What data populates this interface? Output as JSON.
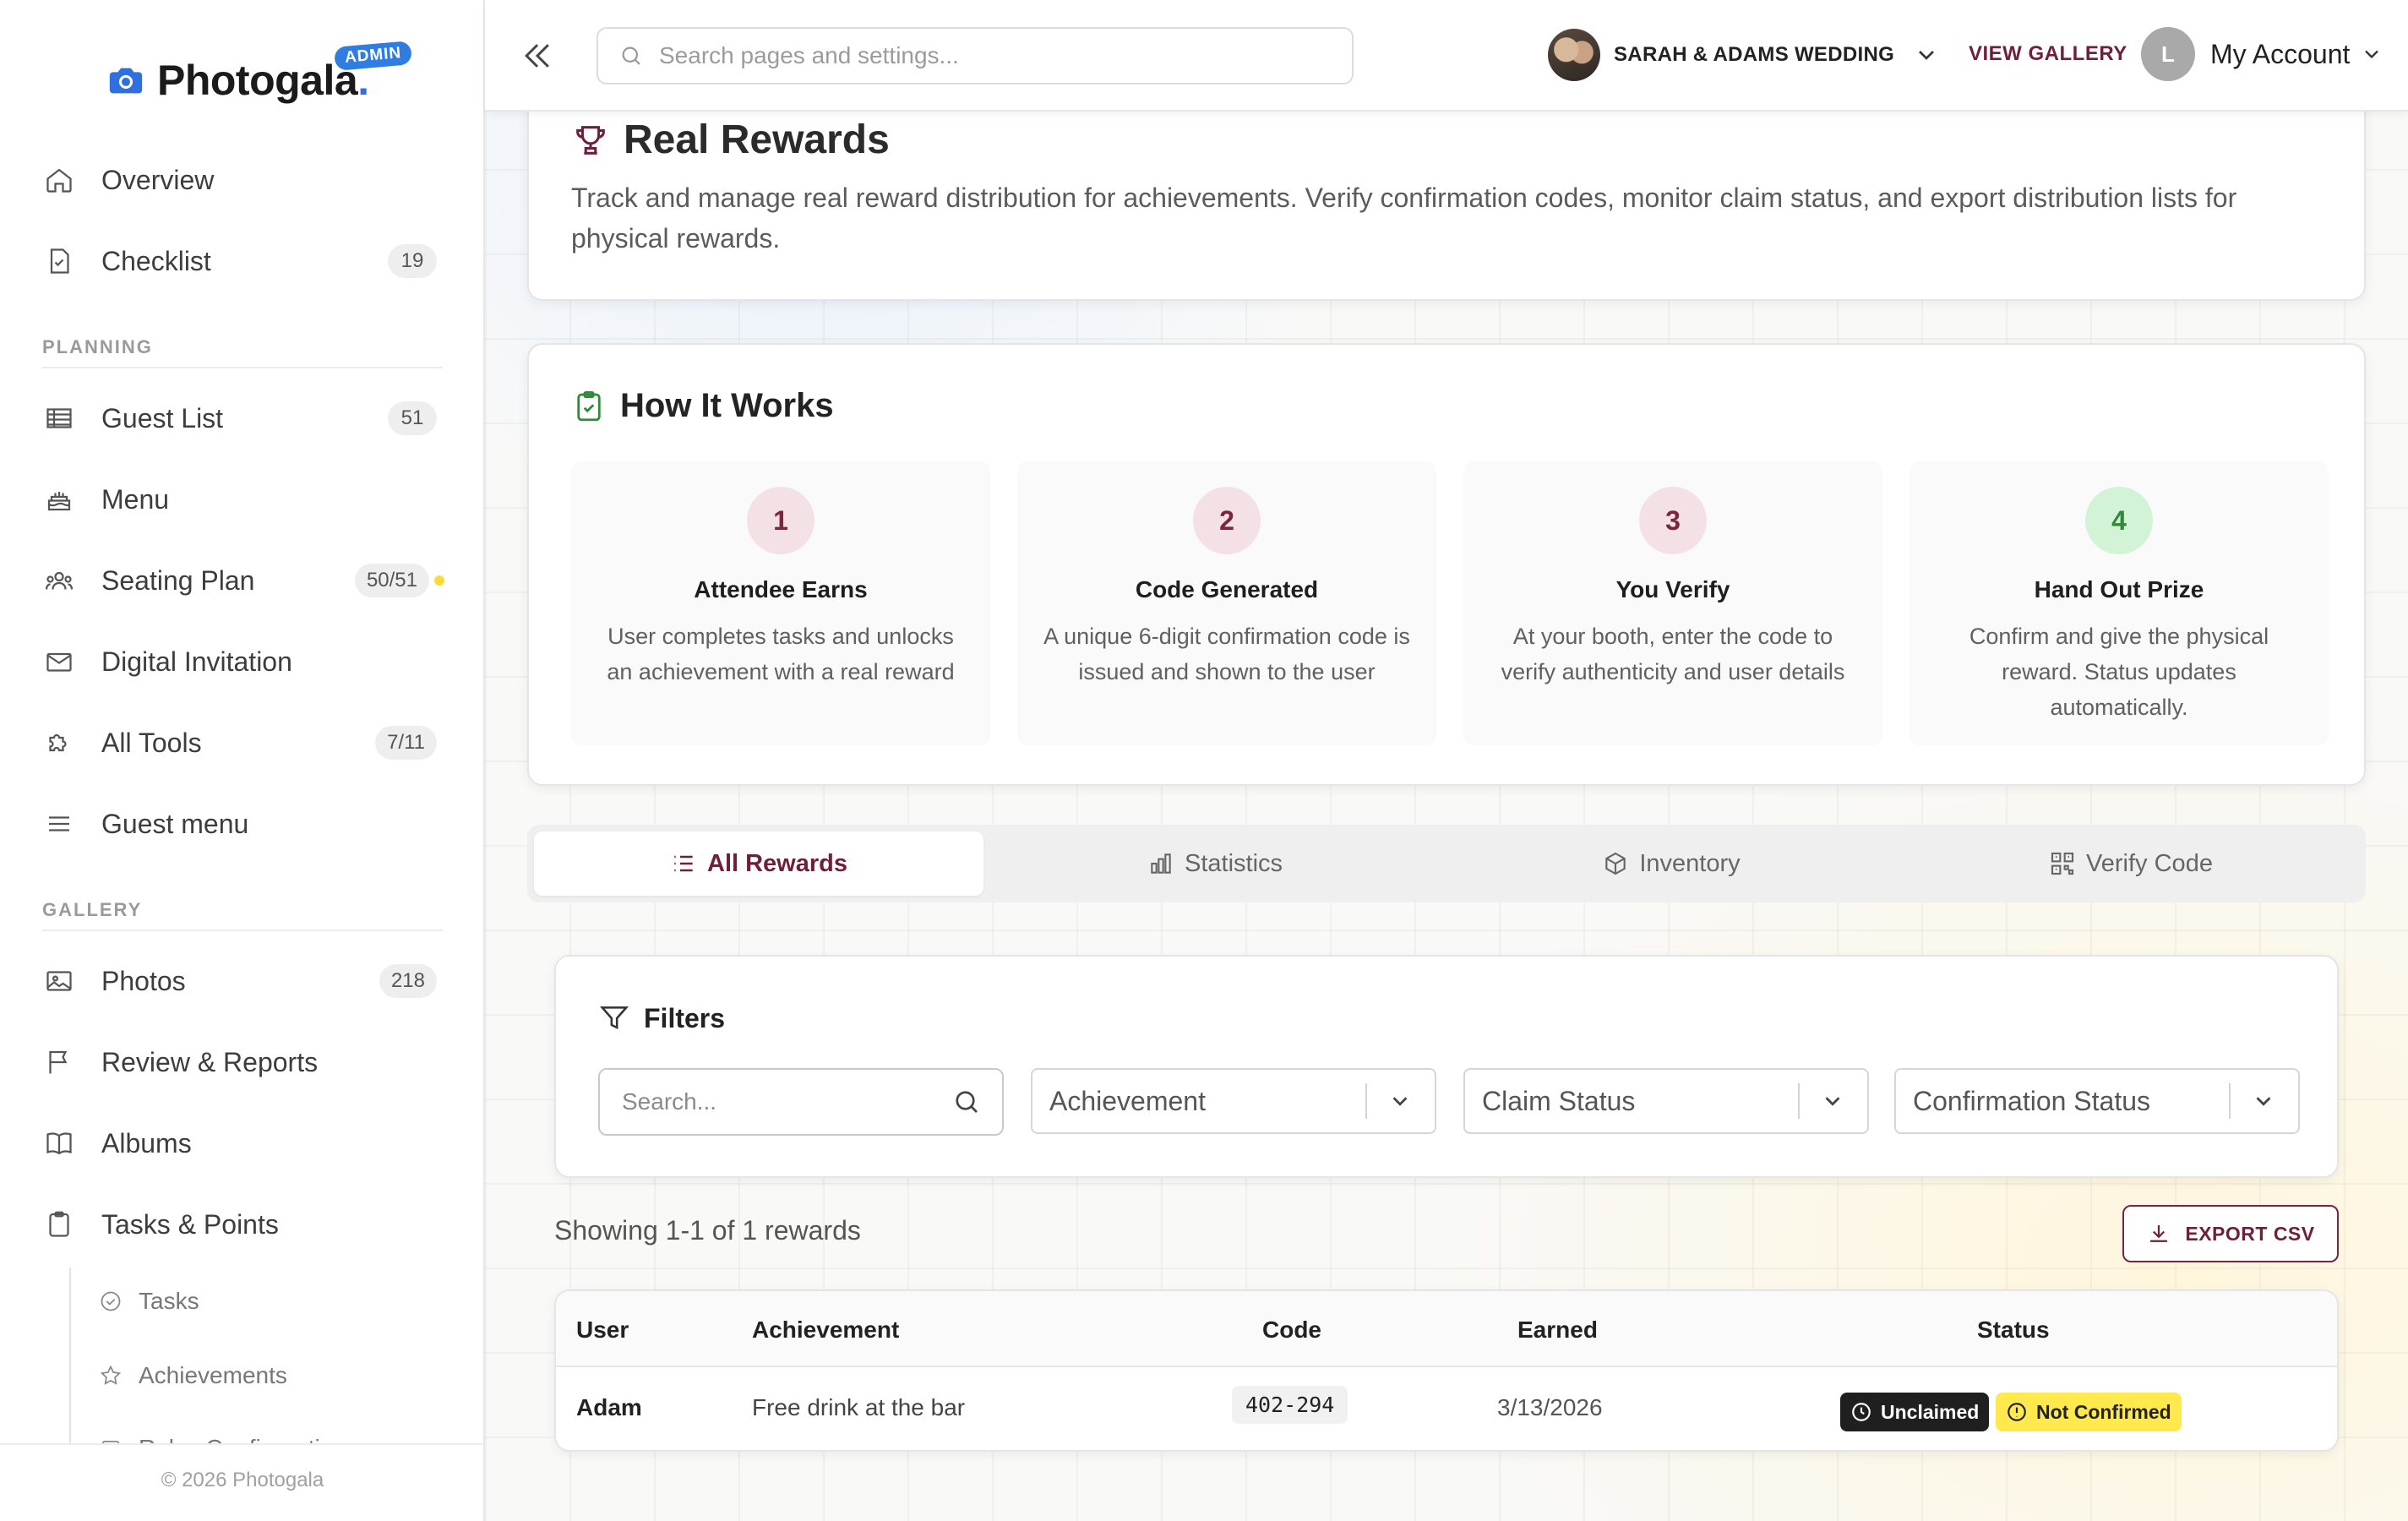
{
  "app": {
    "name": "Photogala",
    "name_dot": ".",
    "admin_badge": "ADMIN",
    "footer": "© 2026 Photogala"
  },
  "sidebar": {
    "items": [
      {
        "label": "Overview",
        "icon": "home-icon"
      },
      {
        "label": "Checklist",
        "count": "19",
        "icon": "checklist-icon"
      }
    ],
    "planning_header": "PLANNING",
    "planning": [
      {
        "label": "Guest List",
        "count": "51",
        "icon": "table-icon"
      },
      {
        "label": "Menu",
        "icon": "cake-icon"
      },
      {
        "label": "Seating Plan",
        "count": "50/51",
        "icon": "people-icon"
      },
      {
        "label": "Digital Invitation",
        "icon": "mail-icon"
      },
      {
        "label": "All Tools",
        "count": "7/11",
        "icon": "puzzle-icon"
      },
      {
        "label": "Guest menu",
        "icon": "menu-icon"
      }
    ],
    "gallery_header": "GALLERY",
    "gallery": [
      {
        "label": "Photos",
        "count": "218",
        "icon": "image-icon"
      },
      {
        "label": "Review & Reports",
        "icon": "flag-icon"
      },
      {
        "label": "Albums",
        "icon": "book-icon"
      },
      {
        "label": "Tasks & Points",
        "icon": "clipboard-icon"
      }
    ],
    "sub_items": [
      {
        "label": "Tasks",
        "icon": "check-circle-icon"
      },
      {
        "label": "Achievements",
        "icon": "star-icon"
      },
      {
        "label": "Rules Configuration",
        "icon": "settings-icon"
      }
    ]
  },
  "header": {
    "search_placeholder": "Search pages and settings...",
    "event_name": "SARAH & ADAMS WEDDING",
    "view_gallery": "VIEW GALLERY",
    "account_initial": "L",
    "account_label": "My Account"
  },
  "page": {
    "title": "Real Rewards",
    "description": "Track and manage real reward distribution for achievements. Verify confirmation codes, monitor claim status, and export distribution lists for physical rewards."
  },
  "how_it_works": {
    "title": "How It Works",
    "steps": [
      {
        "num": "1",
        "title": "Attendee Earns",
        "desc": "User completes tasks and unlocks an achievement with a real reward"
      },
      {
        "num": "2",
        "title": "Code Generated",
        "desc": "A unique 6-digit confirmation code is issued and shown to the user"
      },
      {
        "num": "3",
        "title": "You Verify",
        "desc": "At your booth, enter the code to verify authenticity and user details"
      },
      {
        "num": "4",
        "title": "Hand Out Prize",
        "desc": "Confirm and give the physical reward. Status updates automatically."
      }
    ]
  },
  "tabs": [
    {
      "label": "All Rewards",
      "icon": "list-icon",
      "active": true
    },
    {
      "label": "Statistics",
      "icon": "bar-chart-icon"
    },
    {
      "label": "Inventory",
      "icon": "box-icon"
    },
    {
      "label": "Verify Code",
      "icon": "qr-code-icon"
    }
  ],
  "filters": {
    "title": "Filters",
    "search_placeholder": "Search...",
    "achievement": "Achievement",
    "claim_status": "Claim Status",
    "confirmation_status": "Confirmation Status"
  },
  "results": {
    "showing": "Showing 1-1 of 1 rewards",
    "export_label": "EXPORT CSV"
  },
  "table": {
    "columns": [
      "User",
      "Achievement",
      "Code",
      "Earned",
      "Status"
    ],
    "rows": [
      {
        "user": "Adam",
        "achievement": "Free drink at the bar",
        "code": "402-294",
        "earned": "3/13/2026",
        "claim": "Unclaimed",
        "confirmation": "Not Confirmed"
      }
    ]
  },
  "colors": {
    "brand": "#6e1f3c",
    "accent_blue": "#2f6fdf",
    "badge_yellow": "#ffe94d",
    "badge_dark": "#1f1f1f",
    "step_green": "#d3f3d6"
  }
}
